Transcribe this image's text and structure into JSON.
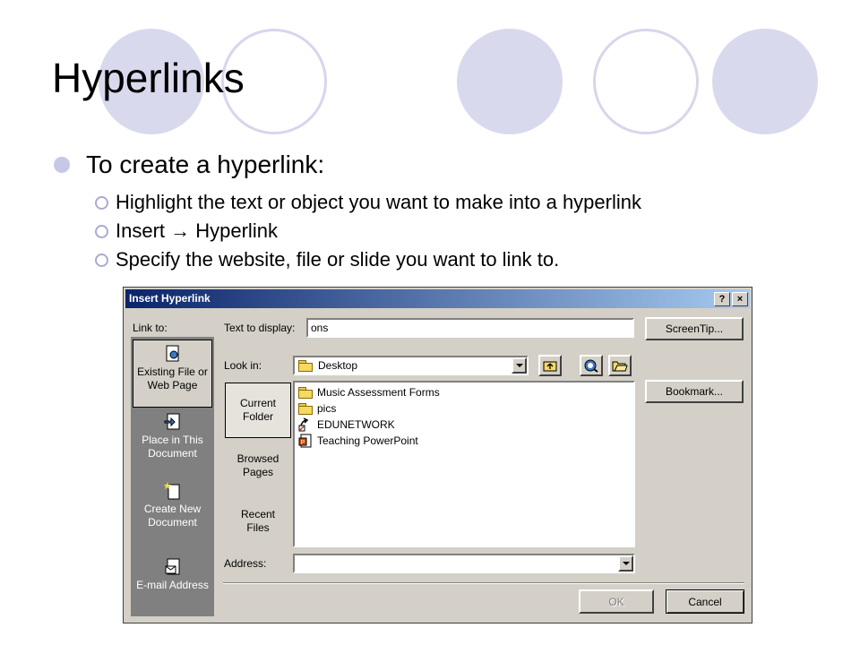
{
  "slide": {
    "title": "Hyperlinks",
    "bullet": "To create a hyperlink:",
    "sub_bullets": [
      "Highlight the text or object you want to make into a hyperlink",
      "Insert → Hyperlink",
      "Specify the website, file or slide you want to link to."
    ]
  },
  "dialog": {
    "title": "Insert Hyperlink",
    "help_button": "?",
    "close_button": "×",
    "link_to_label": "Link to:",
    "text_to_display_label": "Text to display:",
    "text_to_display_value": "ons",
    "screentip_button": "ScreenTip...",
    "look_in_label": "Look in:",
    "look_in_value": "Desktop",
    "bookmark_button": "Bookmark...",
    "address_label": "Address:",
    "address_value": "",
    "ok_button": "OK",
    "cancel_button": "Cancel",
    "link_targets": [
      {
        "line1": "Existing File or",
        "line2": "Web Page"
      },
      {
        "line1": "Place in This",
        "line2": "Document"
      },
      {
        "line1": "Create New",
        "line2": "Document"
      },
      {
        "line1": "E-mail Address",
        "line2": ""
      }
    ],
    "views": [
      {
        "line1": "Current",
        "line2": "Folder"
      },
      {
        "line1": "Browsed",
        "line2": "Pages"
      },
      {
        "line1": "Recent",
        "line2": "Files"
      }
    ],
    "files": [
      {
        "name": "Music Assessment Forms",
        "icon": "folder-icon"
      },
      {
        "name": "pics",
        "icon": "folder-icon"
      },
      {
        "name": "EDUNETWORK",
        "icon": "shortcut-icon"
      },
      {
        "name": "Teaching PowerPoint",
        "icon": "powerpoint-file-icon"
      }
    ]
  }
}
